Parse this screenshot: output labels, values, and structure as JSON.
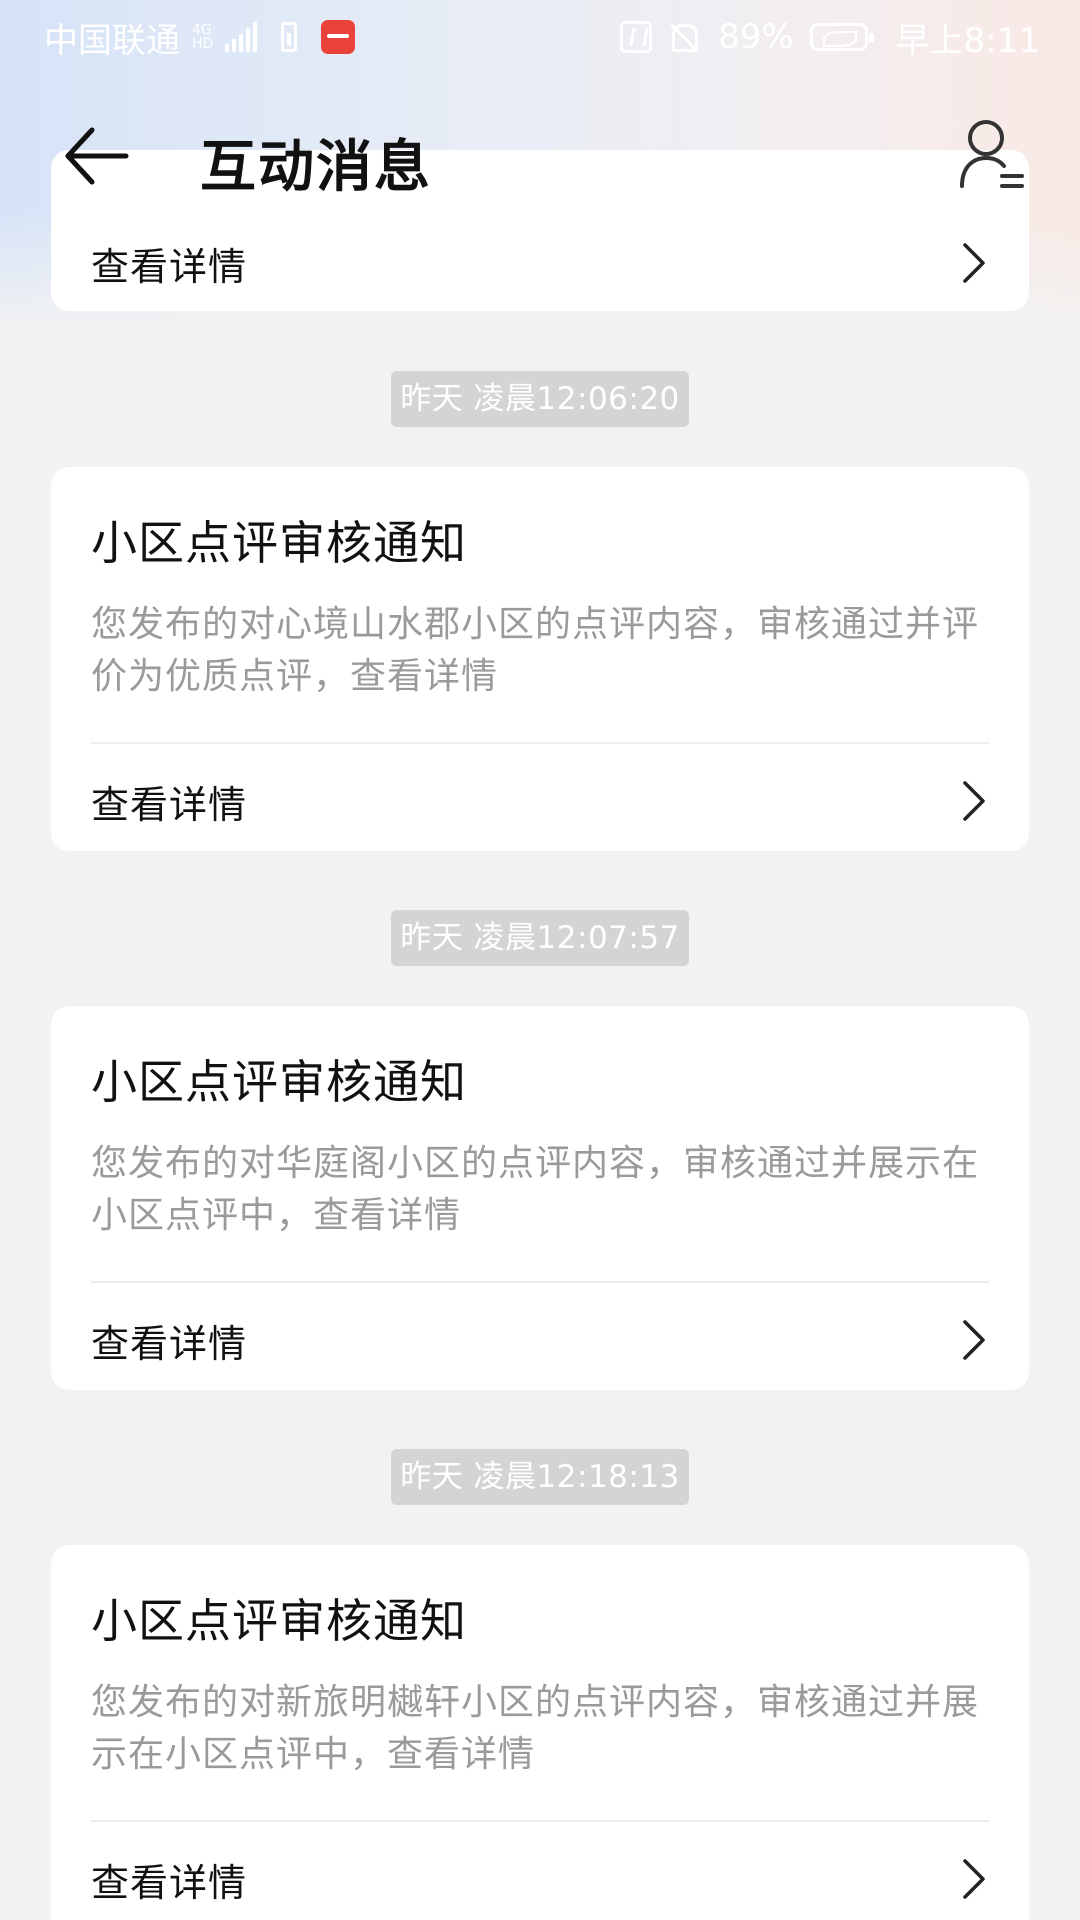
{
  "status_bar": {
    "carrier": "中国联通",
    "network_type": "4G",
    "network_sub": "HD",
    "battery_percent": "89%",
    "time": "早上8:11"
  },
  "header": {
    "title": "互动消息"
  },
  "colors": {
    "card_bg": "#ffffff",
    "page_bg": "#f2f2f2",
    "timestamp_bg": "#d4d4d4",
    "body_text": "#9a9a9a"
  },
  "partial_card": {
    "action_label": "查看详情"
  },
  "messages": [
    {
      "timestamp": "昨天 凌晨12:06:20",
      "title": "小区点评审核通知",
      "body": "您发布的对心境山水郡小区的点评内容，审核通过并评价为优质点评，查看详情",
      "action_label": "查看详情"
    },
    {
      "timestamp": "昨天 凌晨12:07:57",
      "title": "小区点评审核通知",
      "body": "您发布的对华庭阁小区的点评内容，审核通过并展示在小区点评中，查看详情",
      "action_label": "查看详情"
    },
    {
      "timestamp": "昨天 凌晨12:18:13",
      "title": "小区点评审核通知",
      "body": "您发布的对新旅明樾轩小区的点评内容，审核通过并展示在小区点评中，查看详情",
      "action_label": "查看详情"
    }
  ]
}
